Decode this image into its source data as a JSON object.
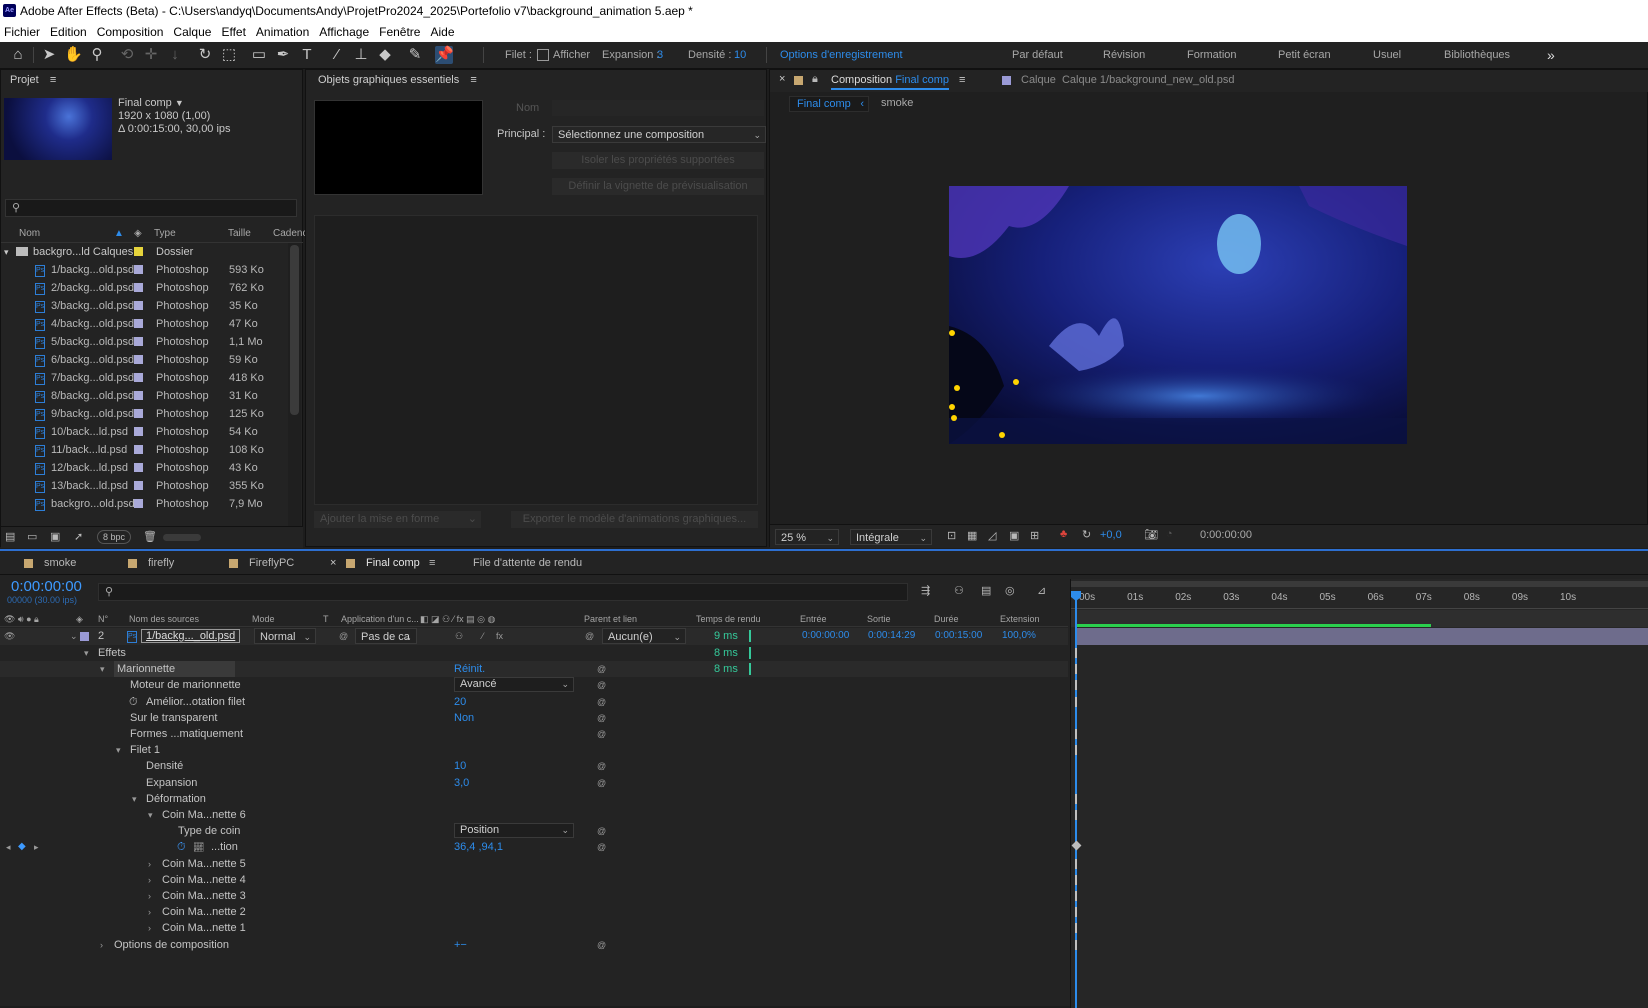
{
  "window": {
    "title": "Adobe After Effects (Beta) - C:\\Users\\andyq\\DocumentsAndy\\ProjetPro2024_2025\\Portefolio v7\\background_animation 5.aep *",
    "app_icon": "Ae"
  },
  "menu": [
    "Fichier",
    "Edition",
    "Composition",
    "Calque",
    "Effet",
    "Animation",
    "Affichage",
    "Fenêtre",
    "Aide"
  ],
  "toolbar": {
    "filet_label": "Filet :",
    "afficher_label": "Afficher",
    "expansion_label": "Expansion :",
    "expansion_value": "3",
    "densite_label": "Densité :",
    "densite_value": "10",
    "options_label": "Options d'enregistrement",
    "workspaces": [
      "Par défaut",
      "Révision",
      "Formation",
      "Petit écran",
      "Usuel",
      "Bibliothèques"
    ],
    "overflow": "»"
  },
  "project": {
    "title": "Projet",
    "comp_name": "Final comp",
    "comp_dims": "1920 x 1080 (1,00)",
    "comp_duration": "Δ 0:00:15:00, 30,00 ips",
    "search_placeholder": "",
    "bpc": "8 bpc",
    "columns": {
      "name": "Nom",
      "type": "Type",
      "size": "Taille",
      "rate": "Cadenc"
    },
    "folder": {
      "name": "backgro...ld Calques",
      "type": "Dossier",
      "color": "#e6d43c"
    },
    "files": [
      {
        "name": "1/backg...old.psd",
        "type": "Photoshop",
        "size": "593 Ko"
      },
      {
        "name": "2/backg...old.psd",
        "type": "Photoshop",
        "size": "762 Ko"
      },
      {
        "name": "3/backg...old.psd",
        "type": "Photoshop",
        "size": "35 Ko"
      },
      {
        "name": "4/backg...old.psd",
        "type": "Photoshop",
        "size": "47 Ko"
      },
      {
        "name": "5/backg...old.psd",
        "type": "Photoshop",
        "size": "1,1 Mo"
      },
      {
        "name": "6/backg...old.psd",
        "type": "Photoshop",
        "size": "59 Ko"
      },
      {
        "name": "7/backg...old.psd",
        "type": "Photoshop",
        "size": "418 Ko"
      },
      {
        "name": "8/backg...old.psd",
        "type": "Photoshop",
        "size": "31 Ko"
      },
      {
        "name": "9/backg...old.psd",
        "type": "Photoshop",
        "size": "125 Ko"
      },
      {
        "name": "10/back...ld.psd",
        "type": "Photoshop",
        "size": "54 Ko"
      },
      {
        "name": "11/back...ld.psd",
        "type": "Photoshop",
        "size": "108 Ko"
      },
      {
        "name": "12/back...ld.psd",
        "type": "Photoshop",
        "size": "43 Ko"
      },
      {
        "name": "13/back...ld.psd",
        "type": "Photoshop",
        "size": "355 Ko"
      },
      {
        "name": "backgro...old.psd",
        "type": "Photoshop",
        "size": "7,9 Mo"
      }
    ]
  },
  "essential": {
    "title": "Objets graphiques essentiels",
    "nom_label": "Nom",
    "principal_label": "Principal :",
    "principal_value": "Sélectionnez une composition",
    "isoler_btn": "Isoler les propriétés supportées",
    "vignette_btn": "Définir la vignette de prévisualisation",
    "ajouter_btn": "Ajouter la mise en forme",
    "exporter_btn": "Exporter le modèle d'animations graphiques..."
  },
  "composition": {
    "tab_prefix": "Composition",
    "tab_name": "Final comp",
    "layer_tab": "Calque",
    "layer_tab_name": "Calque 1/background_new_old.psd",
    "breadcrumbs": [
      "Final comp",
      "smoke"
    ],
    "zoom": "25 %",
    "resolution": "Intégrale",
    "exposure": "+0,0",
    "timecode": "0:00:00:00"
  },
  "timeline": {
    "tabs": [
      "smoke",
      "firefly",
      "FireflyPC",
      "Final comp",
      "File d'attente de rendu"
    ],
    "active_tab": "Final comp",
    "current_time": "0:00:00:00",
    "frame_info": "00000 (30.00 ips)",
    "headers": {
      "num": "N°",
      "source": "Nom des sources",
      "mode": "Mode",
      "t": "T",
      "app": "Application d'un c...",
      "parent": "Parent et lien",
      "render": "Temps de rendu",
      "in": "Entrée",
      "out": "Sortie",
      "dur": "Durée",
      "stretch": "Extension"
    },
    "layer": {
      "num": "2",
      "name": "1/backg..._old.psd",
      "mode": "Normal",
      "trkmat": "Pas de ca",
      "parent": "Aucun(e)",
      "render": "9 ms",
      "in": "0:00:00:00",
      "out": "0:00:14:29",
      "dur": "0:00:15:00",
      "stretch": "100,0%"
    },
    "props": [
      {
        "label": "Effets",
        "indent": 1,
        "arrow": "▾",
        "value": "",
        "render": "8 ms"
      },
      {
        "label": "Marionnette",
        "indent": 2,
        "arrow": "▾",
        "value": "Réinit.",
        "render": "8 ms",
        "fx": true
      },
      {
        "label": "Moteur de marionnette",
        "indent": 3,
        "arrow": "",
        "dropdown": "Avancé"
      },
      {
        "label": "Amélior...otation filet",
        "indent": 3,
        "arrow": "",
        "value": "20",
        "stopwatch": true
      },
      {
        "label": "Sur le transparent",
        "indent": 3,
        "arrow": "",
        "value": "Non"
      },
      {
        "label": "Formes ...matiquement",
        "indent": 3,
        "arrow": ""
      },
      {
        "label": "Filet 1",
        "indent": 3,
        "arrow": "▾"
      },
      {
        "label": "Densité",
        "indent": 4,
        "arrow": "",
        "value": "10"
      },
      {
        "label": "Expansion",
        "indent": 4,
        "arrow": "",
        "value": "3,0"
      },
      {
        "label": "Déformation",
        "indent": 4,
        "arrow": "▾"
      },
      {
        "label": "Coin Ma...nette 6",
        "indent": 5,
        "arrow": "▾"
      },
      {
        "label": "Type de coin",
        "indent": 6,
        "arrow": "",
        "dropdown": "Position"
      },
      {
        "label": "...tion",
        "indent": 6,
        "arrow": "",
        "value": "36,4 ,94,1",
        "stopwatch": true,
        "keyframe": true
      },
      {
        "label": "Coin Ma...nette 5",
        "indent": 5,
        "arrow": "›"
      },
      {
        "label": "Coin Ma...nette 4",
        "indent": 5,
        "arrow": "›"
      },
      {
        "label": "Coin Ma...nette 3",
        "indent": 5,
        "arrow": "›"
      },
      {
        "label": "Coin Ma...nette 2",
        "indent": 5,
        "arrow": "›"
      },
      {
        "label": "Coin Ma...nette 1",
        "indent": 5,
        "arrow": "›"
      },
      {
        "label": "Options de composition",
        "indent": 2,
        "arrow": "›",
        "value": "+−"
      }
    ],
    "ruler": [
      "00s",
      "01s",
      "02s",
      "03s",
      "04s",
      "05s",
      "06s",
      "07s",
      "08s",
      "09s",
      "10s"
    ]
  }
}
